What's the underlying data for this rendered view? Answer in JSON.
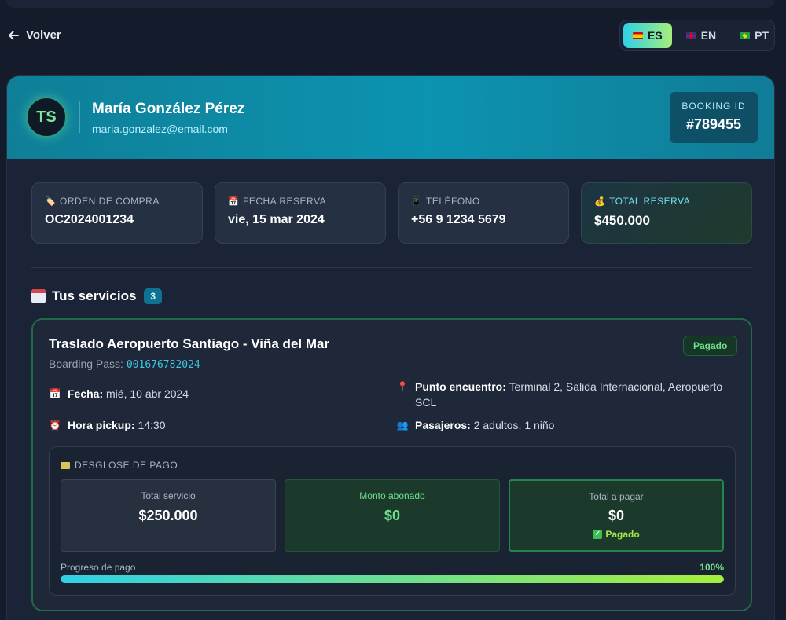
{
  "nav": {
    "back_label": "Volver"
  },
  "languages": [
    {
      "code": "ES",
      "flag": "spain-flag-icon",
      "active": true
    },
    {
      "code": "EN",
      "flag": "uk-flag-icon",
      "active": false
    },
    {
      "code": "PT",
      "flag": "brazil-flag-icon",
      "active": false
    }
  ],
  "header": {
    "avatar_initials": "TS",
    "name": "María González Pérez",
    "email": "maria.gonzalez@email.com",
    "booking_label": "BOOKING ID",
    "booking_id": "#789455"
  },
  "info_cards": [
    {
      "icon": "🏷️",
      "label": "ORDEN DE COMPRA",
      "value": "OC2024001234"
    },
    {
      "icon": "📅",
      "label": "FECHA RESERVA",
      "value": "vie, 15 mar 2024"
    },
    {
      "icon": "📱",
      "label": "TELÉFONO",
      "value": "+56 9 1234 5679"
    },
    {
      "icon": "💰",
      "label": "TOTAL RESERVA",
      "value": "$450.000"
    }
  ],
  "services": {
    "title": "Tus servicios",
    "count": "3",
    "items": [
      {
        "title": "Traslado Aeropuerto Santiago - Viña del Mar",
        "boarding_label": "Boarding Pass:",
        "boarding_code": "001676782024",
        "status": "Pagado",
        "details": {
          "fecha_label": "Fecha:",
          "fecha_value": "mié, 10 abr 2024",
          "hora_label": "Hora pickup:",
          "hora_value": "14:30",
          "punto_label": "Punto encuentro:",
          "punto_value": "Terminal 2, Salida Internacional, Aeropuerto SCL",
          "pasajeros_label": "Pasajeros:",
          "pasajeros_value": "2 adultos, 1 niño"
        },
        "breakdown": {
          "title": "DESGLOSE DE PAGO",
          "total_service_label": "Total servicio",
          "total_service_value": "$250.000",
          "paid_label": "Monto abonado",
          "paid_value": "$0",
          "due_label": "Total a pagar",
          "due_value": "$0",
          "due_status": "Pagado",
          "progress_label": "Progreso de pago",
          "progress_text": "100%",
          "progress_value": 100
        }
      }
    ]
  },
  "colors": {
    "accent_cyan": "#2fd0e6",
    "accent_green": "#6ee08c",
    "header_teal": "#0c93b0",
    "background": "#141c2b"
  }
}
